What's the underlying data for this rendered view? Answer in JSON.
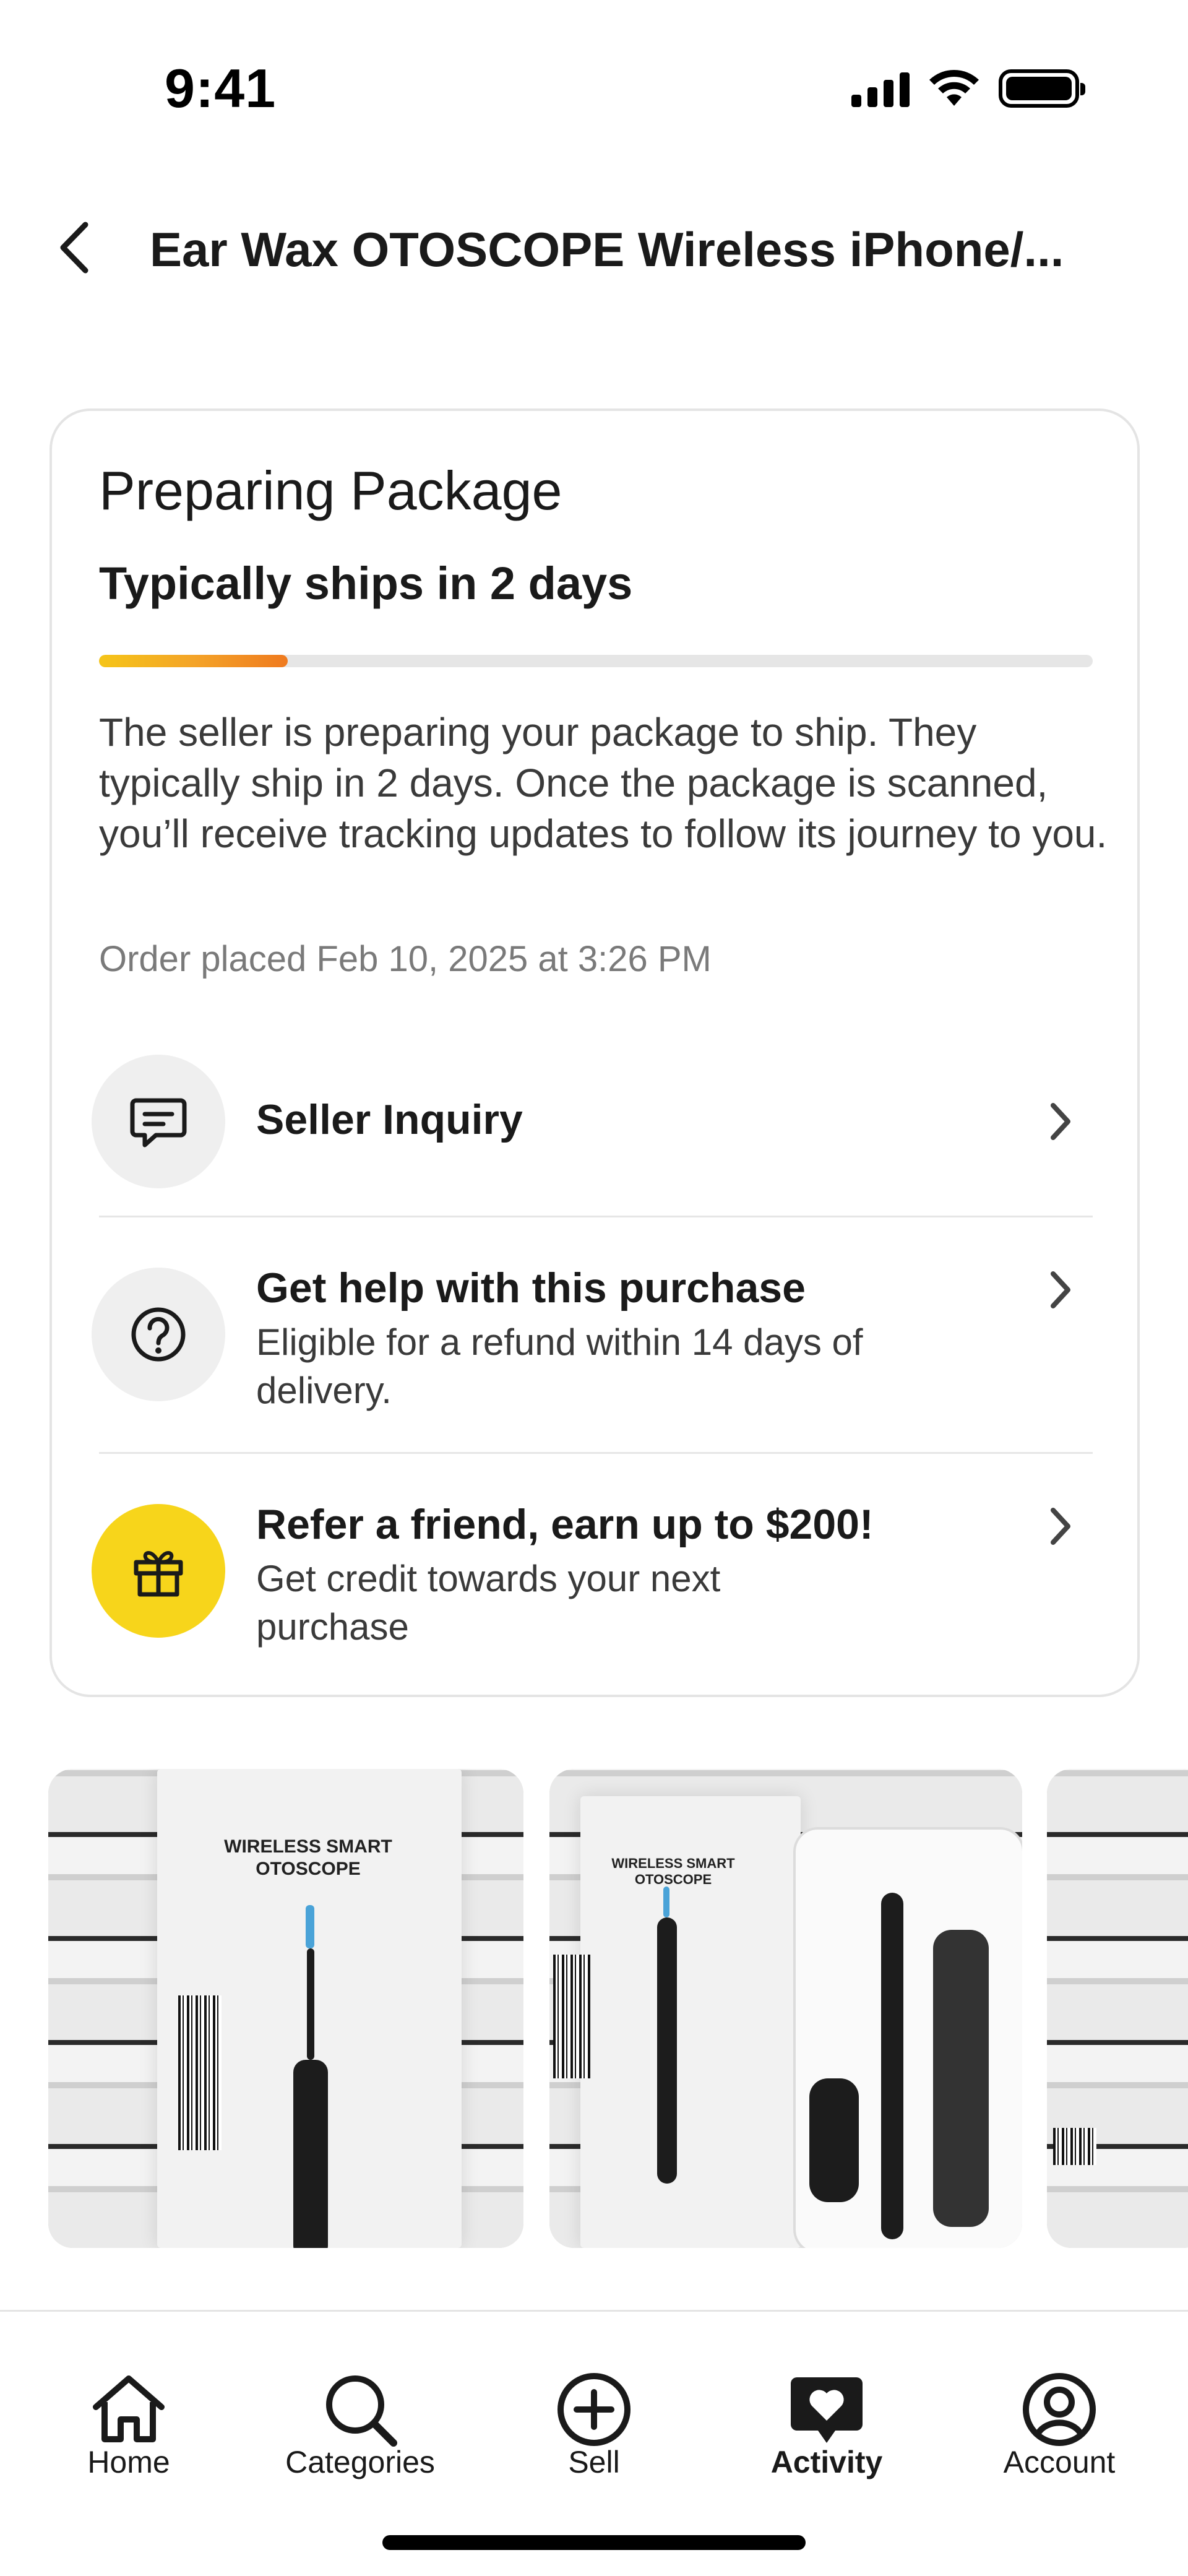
{
  "status_bar": {
    "time": "9:41"
  },
  "header": {
    "title": "Ear Wax OTOSCOPE Wireless iPhone/..."
  },
  "status_card": {
    "title": "Preparing Package",
    "subtitle": "Typically ships in 2 days",
    "progress_fraction": 0.19,
    "description": "The seller is preparing your package to ship. They typically ship in 2 days. Once the package is scanned, you’ll receive tracking updates to follow its journey to you.",
    "order_placed": "Order placed Feb 10, 2025 at 3:26 PM",
    "accent_gradient": [
      "#f5c518",
      "#f4a428",
      "#ef7a1f"
    ]
  },
  "actions": [
    {
      "icon": "chat-icon",
      "title": "Seller Inquiry",
      "subtitle": ""
    },
    {
      "icon": "question-circle-icon",
      "title": "Get help with this purchase",
      "subtitle": "Eligible for a refund within 14 days of delivery."
    },
    {
      "icon": "gift-icon",
      "title": "Refer a friend, earn up to $200!",
      "subtitle": "Get credit towards your next purchase",
      "icon_bg": "#f7d51b"
    }
  ],
  "photos": [
    {
      "box_label": "WIRELESS SMART OTOSCOPE"
    },
    {
      "box_label": "WIRELESS SMART OTOSCOPE"
    },
    {
      "box_label": ""
    }
  ],
  "tab_bar": {
    "tabs": [
      {
        "icon": "home-icon",
        "label": "Home",
        "active": false
      },
      {
        "icon": "search-icon",
        "label": "Categories",
        "active": false
      },
      {
        "icon": "plus-circle-icon",
        "label": "Sell",
        "active": false
      },
      {
        "icon": "heart-chat-icon",
        "label": "Activity",
        "active": true
      },
      {
        "icon": "account-icon",
        "label": "Account",
        "active": false
      }
    ]
  }
}
